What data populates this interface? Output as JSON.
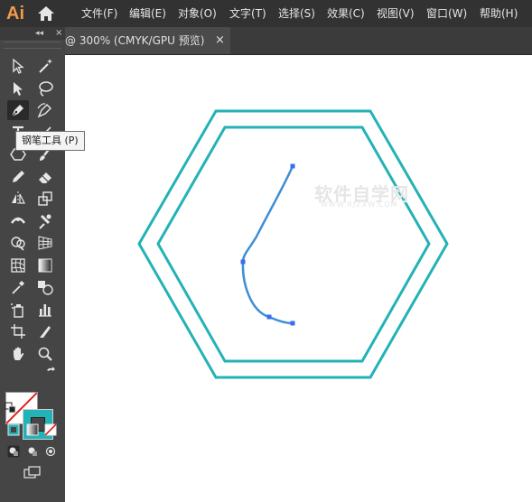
{
  "app": {
    "logo": "Ai"
  },
  "menu": [
    {
      "label": "文件(F)"
    },
    {
      "label": "编辑(E)"
    },
    {
      "label": "对象(O)"
    },
    {
      "label": "文字(T)"
    },
    {
      "label": "选择(S)"
    },
    {
      "label": "效果(C)"
    },
    {
      "label": "视图(V)"
    },
    {
      "label": "窗口(W)"
    },
    {
      "label": "帮助(H)"
    }
  ],
  "document": {
    "tab_title": "@ 300% (CMYK/GPU 预览)",
    "close_glyph": "×"
  },
  "toolbox": {
    "collapse_glyph": "◂◂",
    "close_glyph": "×"
  },
  "tooltip": {
    "text": "钢笔工具 (P)"
  },
  "watermark": {
    "text": "软件自学网",
    "sub": "WWW.RJZXW.COM"
  },
  "colors": {
    "stroke": "#23b2b6",
    "path": "#3d8fd6",
    "anchor": "#3b6cf0",
    "accent": "#f29a4a"
  },
  "tools": [
    {
      "name": "selection-tool-icon"
    },
    {
      "name": "magic-wand-tool-icon"
    },
    {
      "name": "direct-selection-tool-icon"
    },
    {
      "name": "lasso-tool-icon"
    },
    {
      "name": "pen-tool-icon"
    },
    {
      "name": "curvature-tool-icon"
    },
    {
      "name": "type-tool-icon"
    },
    {
      "name": "line-segment-tool-icon"
    },
    {
      "name": "shape-tool-icon"
    },
    {
      "name": "paintbrush-tool-icon"
    },
    {
      "name": "pencil-tool-icon"
    },
    {
      "name": "eraser-tool-icon"
    },
    {
      "name": "reflect-tool-icon"
    },
    {
      "name": "scale-tool-icon"
    },
    {
      "name": "width-tool-icon"
    },
    {
      "name": "puppet-warp-tool-icon"
    },
    {
      "name": "shape-builder-tool-icon"
    },
    {
      "name": "perspective-grid-tool-icon"
    },
    {
      "name": "mesh-tool-icon"
    },
    {
      "name": "gradient-tool-icon"
    },
    {
      "name": "eyedropper-tool-icon"
    },
    {
      "name": "blend-tool-icon"
    },
    {
      "name": "symbol-sprayer-tool-icon"
    },
    {
      "name": "column-graph-tool-icon"
    },
    {
      "name": "artboard-tool-icon"
    },
    {
      "name": "slice-tool-icon"
    },
    {
      "name": "hand-tool-icon"
    },
    {
      "name": "zoom-tool-icon"
    }
  ]
}
